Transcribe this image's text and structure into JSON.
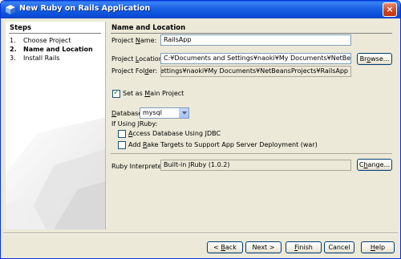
{
  "window": {
    "title": "New Ruby on Rails Application",
    "close_label": "×"
  },
  "steps": {
    "heading": "Steps",
    "items": [
      {
        "num": "1.",
        "label": "Choose Project"
      },
      {
        "num": "2.",
        "label": "Name and Location"
      },
      {
        "num": "3.",
        "label": "Install Rails"
      }
    ]
  },
  "section": {
    "title": "Name and Location"
  },
  "form": {
    "project_name": {
      "label_pre": "Project ",
      "label_mn": "N",
      "label_post": "ame:",
      "value": "RailsApp"
    },
    "project_location": {
      "label_pre": "Project ",
      "label_mn": "L",
      "label_post": "ocation:",
      "value": "C:¥Documents and Settings¥naoki¥My Documents¥NetBeansProjects",
      "browse_pre": "Br",
      "browse_mn": "o",
      "browse_post": "wse..."
    },
    "project_folder": {
      "label_pre": "Project Fol",
      "label_mn": "d",
      "label_post": "er:",
      "value": "C:¥Documents and Settings¥naoki¥My Documents¥NetBeansProjects¥RailsApp"
    },
    "main_project": {
      "label_pre": "Set as ",
      "label_mn": "M",
      "label_post": "ain Project",
      "checked": true
    },
    "database": {
      "label_pre": "",
      "label_mn": "D",
      "label_post": "atabase:",
      "value": "mysql"
    },
    "jruby_heading": "If Using JRuby:",
    "jdbc": {
      "label_pre": "",
      "label_mn": "A",
      "label_post": "ccess Database Using JDBC",
      "checked": false
    },
    "rake": {
      "label_pre": "Add ",
      "label_mn": "R",
      "label_post": "ake Targets to Support App Server Deployment (war)",
      "checked": false
    },
    "interpreter": {
      "label": "Ruby Interpreter:",
      "value": "Built-in JRuby (1.0.2)",
      "change_pre": "C",
      "change_mn": "h",
      "change_post": "ange..."
    }
  },
  "footer": {
    "back_pre": "< ",
    "back_mn": "B",
    "back_post": "ack",
    "next_pre": "Next >",
    "next_mn": "",
    "next_post": "",
    "finish_pre": "",
    "finish_mn": "F",
    "finish_post": "inish",
    "cancel_label": "Cancel",
    "help_pre": "",
    "help_mn": "H",
    "help_post": "elp"
  },
  "colors": {
    "titlebar": "#0a4fd8",
    "dialog_bg": "#ece9d8",
    "field_border": "#7f9db9",
    "button_border": "#003c74"
  }
}
